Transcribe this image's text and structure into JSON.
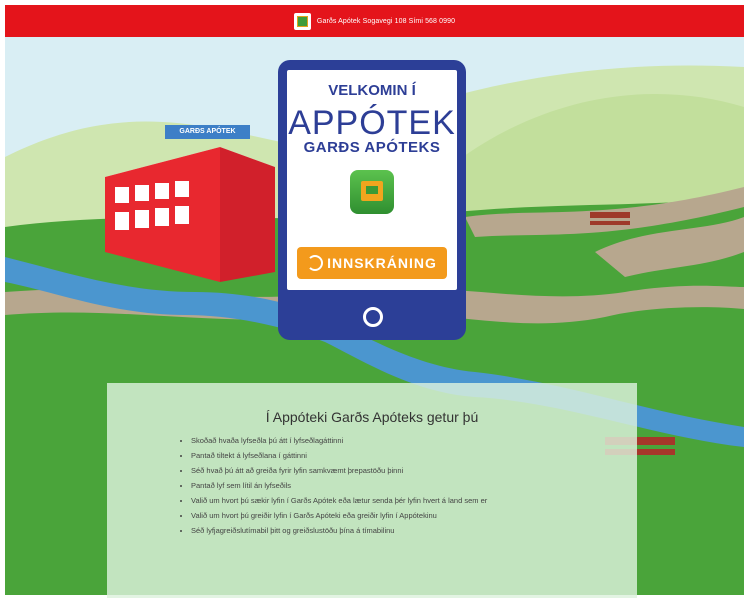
{
  "topbar": {
    "text": "Garðs Apótek Sogavegi 108 Sími 568 0990",
    "icon": "cart-logo-icon"
  },
  "phone": {
    "welcome": "VELKOMIN Í",
    "brand": "APPÓTEK",
    "subbrand": "GARÐS APÓTEKS",
    "login_label": "INNSKRÁNING",
    "app_icon": "cart-app-icon"
  },
  "building": {
    "sign": "GARÐS APÓTEK"
  },
  "info": {
    "title": "Í Appóteki Garðs Apóteks getur þú",
    "items": [
      "Skoðað hvaða lyfseðla þú átt í lyfseðlagáttinni",
      "Pantað tiltekt á lyfseðlana í gáttinni",
      "Séð hvað þú átt að greiða fyrir lyfin samkvæmt þrepastöðu þinni",
      "Pantað lyf sem lítil án lyfseðils",
      "Valið um hvort þú sækir lyfin í Garðs Apótek eða lætur senda þér lyfin hvert á land sem er",
      "Valið um hvort þú greiðir lyfin í Garðs Apóteki eða greiðir lyfin í Appótekinu",
      "Séð lyfjagreiðslutímabil þitt og greiðslustöðu þína á tímabilinu"
    ]
  },
  "colors": {
    "topbar": "#e4141b",
    "phone": "#2c3f97",
    "login": "#f39a1c"
  }
}
